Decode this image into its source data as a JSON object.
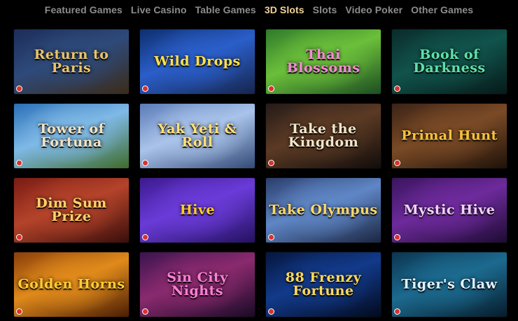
{
  "nav": {
    "tabs": [
      {
        "label": "Featured Games",
        "active": false
      },
      {
        "label": "Live Casino",
        "active": false
      },
      {
        "label": "Table Games",
        "active": false
      },
      {
        "label": "3D Slots",
        "active": true
      },
      {
        "label": "Slots",
        "active": false
      },
      {
        "label": "Video Poker",
        "active": false
      },
      {
        "label": "Other Games",
        "active": false
      }
    ]
  },
  "colors": {
    "background": "#000000",
    "tab_text": "#8c8c8c",
    "tab_active": "#f2d29a"
  },
  "games": [
    {
      "title": "Return to Paris",
      "text_color": "#e9c46a",
      "bg": [
        "#1c2d5a",
        "#2e4a7a",
        "#3b2b1a"
      ]
    },
    {
      "title": "Wild Drops",
      "text_color": "#ffe14a",
      "bg": [
        "#0e2f6e",
        "#2a5ec9",
        "#16254d"
      ]
    },
    {
      "title": "Thai Blossoms",
      "text_color": "#f58ad6",
      "bg": [
        "#2f7a2b",
        "#6bbf3a",
        "#1d4d22"
      ]
    },
    {
      "title": "Book of Darkness",
      "text_color": "#5fe0a8",
      "bg": [
        "#0a2b2a",
        "#11534c",
        "#061a19"
      ]
    },
    {
      "title": "Tower of Fortuna",
      "text_color": "#f3e3c3",
      "bg": [
        "#2a6fb8",
        "#7fb9e6",
        "#3f6b2a"
      ]
    },
    {
      "title": "Yak Yeti & Roll",
      "text_color": "#ffe07a",
      "bg": [
        "#5b7bb8",
        "#a9c3ea",
        "#334a77"
      ]
    },
    {
      "title": "Take the Kingdom",
      "text_color": "#f2e6c9",
      "bg": [
        "#241b18",
        "#5b3a24",
        "#120d0b"
      ]
    },
    {
      "title": "Primal Hunt",
      "text_color": "#f7c23c",
      "bg": [
        "#3b2316",
        "#7a4a26",
        "#1f1209"
      ]
    },
    {
      "title": "Dim Sum Prize",
      "text_color": "#ffd36a",
      "bg": [
        "#7a1b14",
        "#b4432a",
        "#3a0e0b"
      ]
    },
    {
      "title": "Hive",
      "text_color": "#ffcc2a",
      "bg": [
        "#3b1a8e",
        "#6a3bd8",
        "#241160"
      ]
    },
    {
      "title": "Take Olympus",
      "text_color": "#ffd86b",
      "bg": [
        "#2a3d6b",
        "#5f86c5",
        "#1a2642"
      ]
    },
    {
      "title": "Mystic Hive",
      "text_color": "#f3d3ff",
      "bg": [
        "#3a155e",
        "#6d2a9b",
        "#1e0b33"
      ]
    },
    {
      "title": "Golden Horns",
      "text_color": "#ffcc33",
      "bg": [
        "#8a3e0a",
        "#e08a1b",
        "#4a1d04"
      ]
    },
    {
      "title": "Sin City Nights",
      "text_color": "#ff7fd6",
      "bg": [
        "#3b1450",
        "#8a2a6e",
        "#190a26"
      ]
    },
    {
      "title": "88 Frenzy Fortune",
      "text_color": "#ffd95a",
      "bg": [
        "#06163e",
        "#123a8a",
        "#020a1e"
      ]
    },
    {
      "title": "Tiger's Claw",
      "text_color": "#dff3ff",
      "bg": [
        "#0b3550",
        "#1c6a8f",
        "#061c2b"
      ]
    }
  ]
}
